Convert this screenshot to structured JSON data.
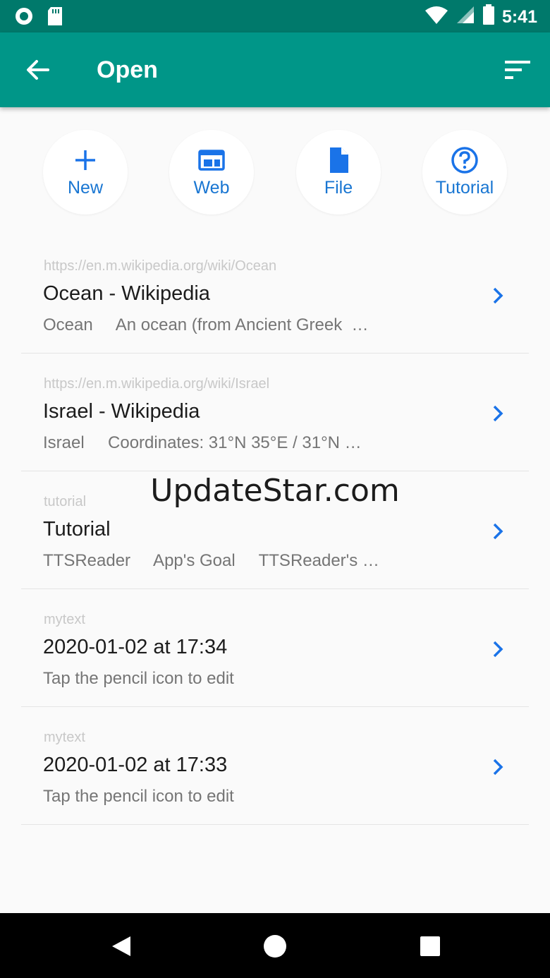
{
  "status_bar": {
    "time": "5:41",
    "icons": [
      "circle-notification-icon",
      "sd-card-icon",
      "wifi-icon",
      "signal-icon",
      "battery-icon"
    ]
  },
  "app_bar": {
    "title": "Open",
    "icons": [
      "back-arrow-icon",
      "sort-icon"
    ]
  },
  "actions": [
    {
      "label": "New",
      "icon": "plus-icon"
    },
    {
      "label": "Web",
      "icon": "web-icon"
    },
    {
      "label": "File",
      "icon": "file-icon"
    },
    {
      "label": "Tutorial",
      "icon": "help-icon"
    }
  ],
  "recent": [
    {
      "source": "https://en.m.wikipedia.org/wiki/Ocean",
      "title": "Ocean - Wikipedia",
      "snippet": "Ocean     An ocean (from Ancient Greek  …"
    },
    {
      "source": "https://en.m.wikipedia.org/wiki/Israel",
      "title": "Israel - Wikipedia",
      "snippet": "Israel     Coordinates: 31°N 35°E / 31°N …"
    },
    {
      "source": "tutorial",
      "title": "Tutorial",
      "snippet": "TTSReader     App's Goal     TTSReader's …"
    },
    {
      "source": "mytext",
      "title": "2020-01-02 at 17:34",
      "snippet": "Tap the pencil icon to edit"
    },
    {
      "source": "mytext",
      "title": "2020-01-02 at 17:33",
      "snippet": "Tap the pencil icon to edit"
    }
  ],
  "watermark": "UpdateStar.com",
  "colors": {
    "status_bar": "#00796b",
    "app_bar": "#009688",
    "accent": "#1976d2"
  }
}
